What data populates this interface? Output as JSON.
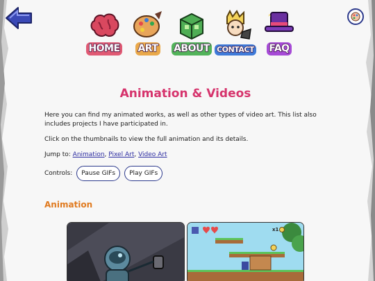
{
  "nav": {
    "items": [
      {
        "label": "HOME",
        "icon": "brain-icon"
      },
      {
        "label": "ART",
        "icon": "palette-icon"
      },
      {
        "label": "ABOUT",
        "icon": "cube-icon"
      },
      {
        "label": "CONTACT",
        "icon": "character-icon"
      },
      {
        "label": "FAQ",
        "icon": "top-hat-icon"
      }
    ]
  },
  "page": {
    "title": "Animation & Videos",
    "intro": "Here you can find my animated works, as well as other types of video art. This list also includes projects I have participated in.",
    "instructions": "Click on the thumbnails to view the full animation and its details.",
    "jump_label": "Jump to:",
    "jump_links": [
      "Animation",
      "Pixel Art",
      "Video Art"
    ],
    "controls_label": "Controls:",
    "pause_label": "Pause GIFs",
    "play_label": "Play GIFs"
  },
  "section": {
    "title": "Animation"
  },
  "thumbnails": [
    {
      "name": "astronaut-animation-thumbnail"
    },
    {
      "name": "platformer-game-thumbnail",
      "hud_counter": "x1"
    }
  ],
  "colors": {
    "accent_title": "#d6336c",
    "section_title": "#e07a1f",
    "button_border": "#2d3a8c",
    "link": "#2b2ba0"
  }
}
